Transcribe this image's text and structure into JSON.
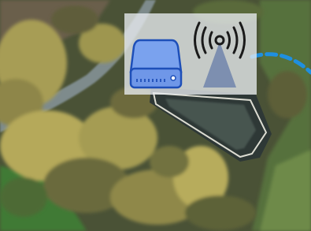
{
  "scene": {
    "description_visible_text": "",
    "colors": {
      "ground_dark": "#3f4a34",
      "grass": "#4f7a3a",
      "field": "#6d7c4a",
      "path": "#7d8a8a",
      "foliage_yellow": "#b8ae5a",
      "foliage_dark": "#5b6036",
      "pond_water": "#2f3a38",
      "pond_rim": "#e8e8e0"
    }
  },
  "overlay": {
    "panel_color": "#e8ecf0",
    "icons": [
      {
        "name": "hard-drive-icon",
        "color": "#6f97e8",
        "stroke": "#1e4fb8"
      },
      {
        "name": "wireless-tower-icon",
        "color": "#7d8fb0",
        "waves_color": "#1a1a1a"
      }
    ],
    "link": {
      "name": "dashed-link-line",
      "color": "#1f8fe0"
    }
  }
}
